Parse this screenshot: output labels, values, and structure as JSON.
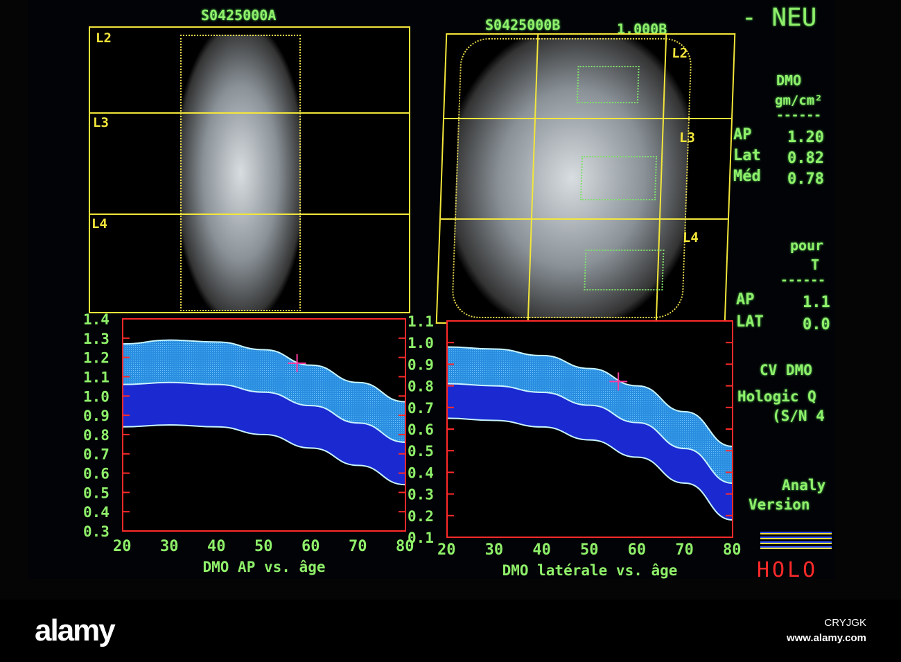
{
  "header": {
    "scan_a": "S0425000A",
    "scan_b": "S0425000B",
    "scale": "1.000B",
    "title_fragment": "- NEU"
  },
  "vertebrae": [
    "L2",
    "L3",
    "L4"
  ],
  "results": {
    "dmo_title": "DMO",
    "dmo_unit": "gm/cm²",
    "divider": "------",
    "rows": [
      {
        "label": "AP",
        "value": "1.20"
      },
      {
        "label": "Lat",
        "value": "0.82"
      },
      {
        "label": "Méd",
        "value": "0.78"
      }
    ],
    "pour_title": "pour",
    "pour_sub": "T",
    "t_rows": [
      {
        "label": "AP",
        "value": "1.1"
      },
      {
        "label": "LAT",
        "value": "0.0"
      }
    ],
    "cv": "CV DMO",
    "hologic": "Hologic Q",
    "sn": "(S/N 4",
    "analysis": "Analy",
    "version": "Version",
    "brand": "HOLO"
  },
  "chart_data": [
    {
      "type": "line",
      "title": "DMO AP vs. âge",
      "xlabel": "",
      "ylabel": "",
      "xlim": [
        20,
        80
      ],
      "ylim": [
        0.3,
        1.4
      ],
      "xticks": [
        "20",
        "30",
        "40",
        "50",
        "60",
        "70",
        "80"
      ],
      "yticks": [
        "1.4",
        "1.3",
        "1.2",
        "1.1",
        "1.0",
        "0.9",
        "0.8",
        "0.7",
        "0.6",
        "0.5",
        "0.4",
        "0.3"
      ],
      "x": [
        20,
        30,
        40,
        50,
        60,
        70,
        80
      ],
      "series": [
        {
          "name": "upper",
          "values": [
            1.27,
            1.29,
            1.28,
            1.24,
            1.16,
            1.07,
            0.97
          ]
        },
        {
          "name": "mean",
          "values": [
            1.06,
            1.07,
            1.06,
            1.02,
            0.95,
            0.86,
            0.76
          ]
        },
        {
          "name": "lower",
          "values": [
            0.84,
            0.85,
            0.84,
            0.8,
            0.73,
            0.64,
            0.54
          ]
        }
      ],
      "patient": {
        "age": 57,
        "value": 1.17
      }
    },
    {
      "type": "line",
      "title": "DMO latérale vs. âge",
      "xlabel": "",
      "ylabel": "",
      "xlim": [
        20,
        80
      ],
      "ylim": [
        0.1,
        1.1
      ],
      "xticks": [
        "20",
        "30",
        "40",
        "50",
        "60",
        "70",
        "80"
      ],
      "yticks": [
        "1.1",
        "1.0",
        "0.9",
        "0.8",
        "0.7",
        "0.6",
        "0.5",
        "0.4",
        "0.3",
        "0.2",
        "0.1"
      ],
      "x": [
        20,
        30,
        40,
        50,
        60,
        70,
        80
      ],
      "series": [
        {
          "name": "upper",
          "values": [
            0.98,
            0.97,
            0.94,
            0.88,
            0.8,
            0.68,
            0.52
          ]
        },
        {
          "name": "mean",
          "values": [
            0.81,
            0.8,
            0.77,
            0.71,
            0.63,
            0.51,
            0.35
          ]
        },
        {
          "name": "lower",
          "values": [
            0.65,
            0.64,
            0.61,
            0.55,
            0.47,
            0.35,
            0.18
          ]
        }
      ],
      "patient": {
        "age": 56,
        "value": 0.82
      }
    }
  ],
  "colors": {
    "text": "#8ff06a",
    "frame": "#f3e63a",
    "plot_border": "#ff2a2a",
    "band_light": "#3aa0e8",
    "band_dark": "#1a2ad0",
    "line": "#c8f4ff",
    "marker": "#ff3aa0"
  },
  "watermark": {
    "logo": "alamy",
    "code": "CRYJGK",
    "url": "www.alamy.com"
  }
}
